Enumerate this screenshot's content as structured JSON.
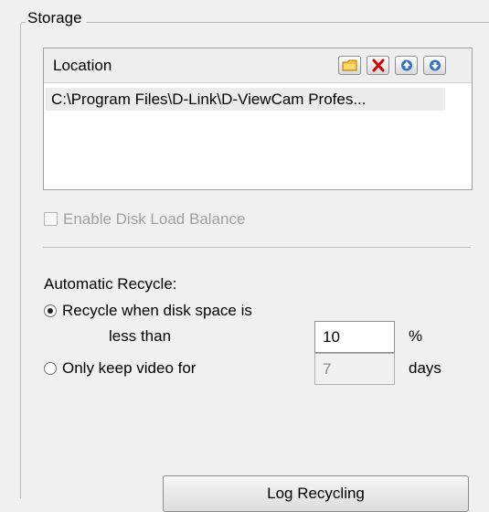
{
  "storage": {
    "title": "Storage",
    "location_header": "Location",
    "toolbar": {
      "add_folder_icon": "folder-icon",
      "delete_icon": "delete-x-icon",
      "move_up_icon": "arrow-up-icon",
      "move_down_icon": "arrow-down-icon"
    },
    "locations": [
      "C:\\Program Files\\D-Link\\D-ViewCam Profes..."
    ],
    "enable_disk_load_balance": {
      "label": "Enable Disk Load Balance",
      "checked": false,
      "enabled": false
    },
    "automatic_recycle": {
      "label": "Automatic Recycle:",
      "option1_line1": "Recycle when disk space is",
      "option1_line2": "less than",
      "option1_value": "10",
      "option1_unit": "%",
      "option1_selected": true,
      "option2_label": "Only keep video for",
      "option2_value": "7",
      "option2_unit": "days",
      "option2_selected": false
    },
    "log_recycling_button": "Log Recycling"
  }
}
